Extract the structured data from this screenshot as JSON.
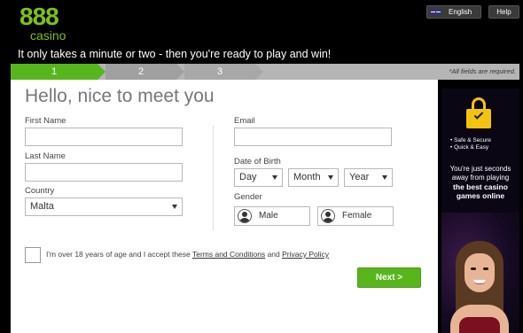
{
  "brand": {
    "logo_number": "888",
    "logo_word": "casino",
    "accent": "#7ec01f"
  },
  "header": {
    "language_label": "English",
    "help_label": "Help",
    "tagline": "It only takes a minute or two - then you're ready to play and win!"
  },
  "steps": {
    "items": [
      "1",
      "2",
      "3"
    ],
    "active_index": 0,
    "required_note": "*All fields are required.",
    "active_color": "#58b61d"
  },
  "form": {
    "title": "Hello, nice to meet you",
    "first_name": {
      "label": "First Name",
      "value": ""
    },
    "last_name": {
      "label": "Last Name",
      "value": ""
    },
    "country": {
      "label": "Country",
      "value": "Malta"
    },
    "email": {
      "label": "Email",
      "value": ""
    },
    "dob": {
      "label": "Date of Birth",
      "day": "Day",
      "month": "Month",
      "year": "Year"
    },
    "gender": {
      "label": "Gender",
      "male": "Male",
      "female": "Female"
    },
    "terms": {
      "prefix": "I'm over 18 years of age and I accept these",
      "terms_link": "Terms and Conditions",
      "and": "and",
      "privacy_link": "Privacy Policy"
    },
    "next_label": "Next >"
  },
  "promo": {
    "bullet1": "• Safe & Secure",
    "bullet2": "• Quick & Easy",
    "line1": "You're just seconds",
    "line2": "away from playing",
    "line3": "the best casino",
    "line4": "games online",
    "icon": "padlock-check-icon",
    "icon_color": "#f2c40f"
  }
}
